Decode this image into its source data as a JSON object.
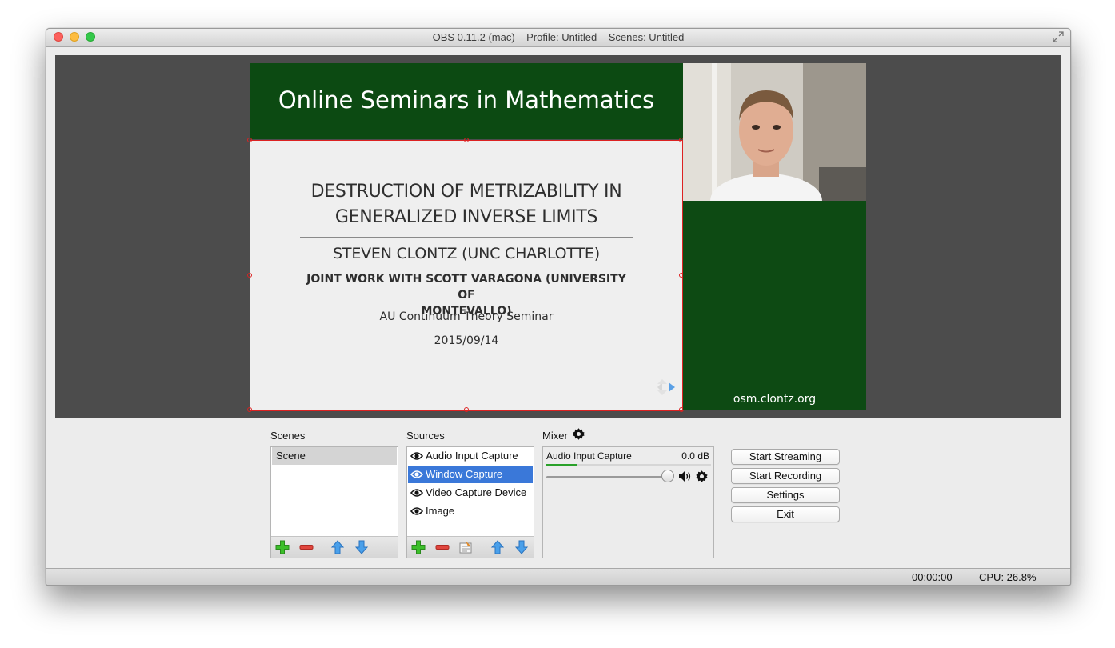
{
  "window": {
    "title": "OBS 0.11.2 (mac) – Profile: Untitled – Scenes: Untitled"
  },
  "preview": {
    "slide_header": "Online Seminars in Mathematics",
    "slide": {
      "title_line1": "DESTRUCTION OF METRIZABILITY IN",
      "title_line2": "GENERALIZED INVERSE LIMITS",
      "author": "STEVEN CLONTZ (UNC CHARLOTTE)",
      "joint_line1": "JOINT WORK WITH SCOTT VARAGONA (UNIVERSITY OF",
      "joint_line2": "MONTEVALLO)",
      "seminar": "AU Continuum Theory Seminar",
      "date": "2015/09/14"
    },
    "side_panel_text": "osm.clontz.org"
  },
  "scenes": {
    "label": "Scenes",
    "items": [
      {
        "label": "Scene",
        "selected": true
      }
    ]
  },
  "sources": {
    "label": "Sources",
    "items": [
      {
        "label": "Audio Input Capture",
        "selected": false
      },
      {
        "label": "Window Capture",
        "selected": true
      },
      {
        "label": "Video Capture Device",
        "selected": false
      },
      {
        "label": "Image",
        "selected": false
      }
    ]
  },
  "mixer": {
    "label": "Mixer",
    "channel": "Audio Input Capture",
    "level": "0.0 dB",
    "meter_fraction": 0.19,
    "volume_fraction": 1.0
  },
  "controls": {
    "start_streaming": "Start Streaming",
    "start_recording": "Start Recording",
    "settings": "Settings",
    "exit": "Exit"
  },
  "status": {
    "time": "00:00:00",
    "cpu": "CPU: 26.8%"
  },
  "colors": {
    "accent": "#3a78d9",
    "slide_green": "#0c4a12",
    "selection_outline": "#dd2222",
    "meter_green": "#2aa12a"
  }
}
